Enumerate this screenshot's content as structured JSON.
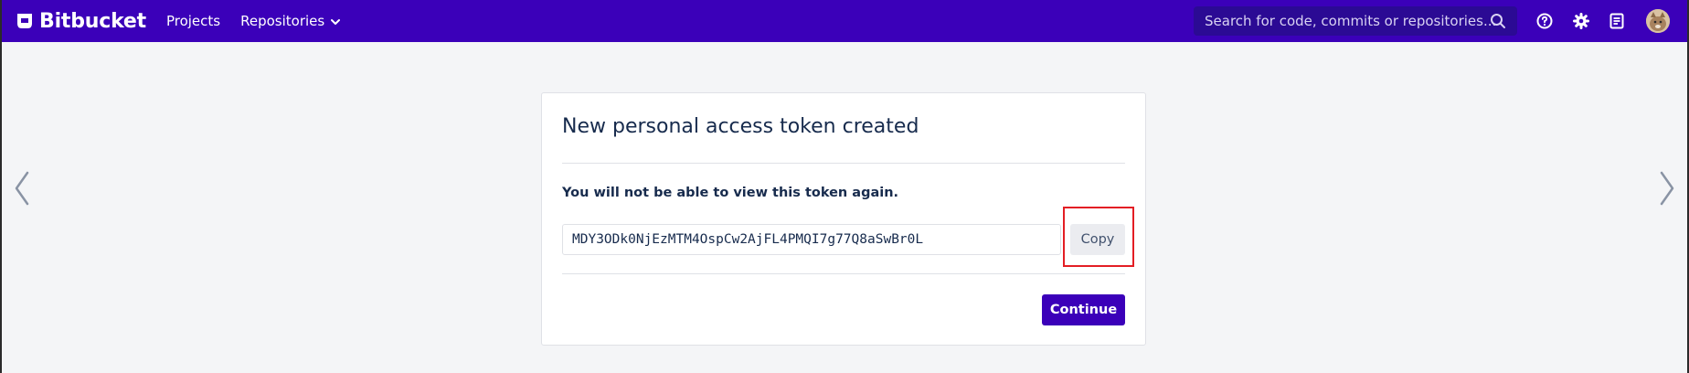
{
  "header": {
    "brand": "Bitbucket",
    "nav": [
      {
        "label": "Projects"
      },
      {
        "label": "Repositories"
      }
    ],
    "search_placeholder": "Search for code, commits or repositories...",
    "icons": [
      "help-icon",
      "settings-icon",
      "notes-icon",
      "avatar"
    ]
  },
  "dialog": {
    "title": "New personal access token created",
    "warning": "You will not be able to view this token again.",
    "token": "MDY3ODk0NjEzMTM4OspCw2AjFL4PMQI7g77Q8aSwBr0L",
    "copy_label": "Copy",
    "continue_label": "Continue"
  },
  "colors": {
    "header_bg": "#3b00b9",
    "page_bg": "#f4f5f7",
    "primary_button": "#3b00b9",
    "highlight": "#e31e24"
  }
}
